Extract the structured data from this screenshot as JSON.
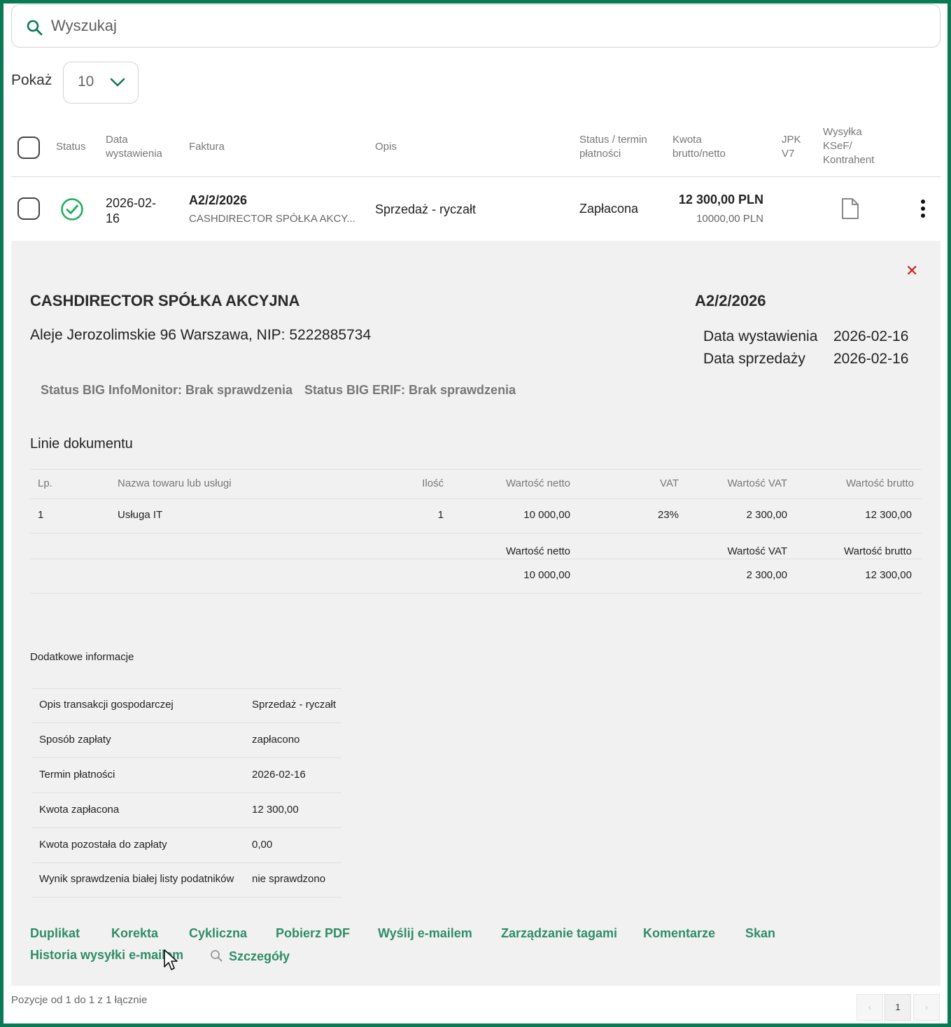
{
  "search": {
    "placeholder": "Wyszukaj"
  },
  "show": {
    "label": "Pokaż",
    "value": "10"
  },
  "table": {
    "headers": {
      "status": "Status",
      "date_line1": "Data",
      "date_line2": "wystawienia",
      "invoice": "Faktura",
      "description": "Opis",
      "payment_line1": "Status / termin",
      "payment_line2": "płatności",
      "amount_line1": "Kwota",
      "amount_line2": "brutto/netto",
      "jpk_line1": "JPK",
      "jpk_line2": "V7",
      "ksef_line1": "Wysyłka",
      "ksef_line2": "KSeF/",
      "ksef_line3": "Kontrahent"
    },
    "row": {
      "date_line1": "2026-02-",
      "date_line2": "16",
      "invoice_number": "A2/2/2026",
      "contractor": "CASHDIRECTOR SPÓŁKA AKCY...",
      "description": "Sprzedaż - ryczałt",
      "payment_status": "Zapłacona",
      "amount_gross": "12 300,00 PLN",
      "amount_net": "10000,00 PLN"
    }
  },
  "detail": {
    "close_symbol": "✕",
    "company": "CASHDIRECTOR SPÓŁKA AKCYJNA",
    "address": "Aleje Jerozolimskie 96 Warszawa, NIP: 5222885734",
    "invoice_number": "A2/2/2026",
    "issue_date_label": "Data wystawienia",
    "issue_date": "2026-02-16",
    "sale_date_label": "Data sprzedaży",
    "sale_date": "2026-02-16",
    "big_infomonitor": "Status BIG InfoMonitor: Brak sprawdzenia",
    "big_erif": "Status BIG ERIF: Brak sprawdzenia",
    "lines_title": "Linie dokumentu",
    "lines_headers": {
      "lp": "Lp.",
      "name": "Nazwa towaru lub usługi",
      "qty": "Ilość",
      "net": "Wartość netto",
      "vat": "VAT",
      "vat_value": "Wartość VAT",
      "gross": "Wartość brutto"
    },
    "lines": [
      {
        "lp": "1",
        "name": "Usługa IT",
        "qty": "1",
        "net": "10 000,00",
        "vat": "23%",
        "vat_value": "2 300,00",
        "gross": "12 300,00"
      }
    ],
    "totals": {
      "net_label": "Wartość netto",
      "vat_label": "Wartość VAT",
      "gross_label": "Wartość brutto",
      "net": "10 000,00",
      "vat": "2 300,00",
      "gross": "12 300,00"
    },
    "info_title": "Dodatkowe informacje",
    "info": [
      {
        "label": "Opis transakcji gospodarczej",
        "value": "Sprzedaż - ryczałt"
      },
      {
        "label": "Sposób zapłaty",
        "value": "zapłacono"
      },
      {
        "label": "Termin płatności",
        "value": "2026-02-16"
      },
      {
        "label": "Kwota zapłacona",
        "value": "12 300,00"
      },
      {
        "label": "Kwota pozostała do zapłaty",
        "value": "0,00"
      },
      {
        "label": "Wynik sprawdzenia białej listy podatników",
        "value": "nie sprawdzono"
      }
    ],
    "actions": {
      "duplicate": "Duplikat",
      "correction": "Korekta",
      "cyclic": "Cykliczna",
      "download_pdf": "Pobierz PDF",
      "send_email": "Wyślij e-mailem",
      "tags": "Zarządzanie tagami",
      "comments": "Komentarze",
      "scan": "Skan",
      "email_history": "Historia wysyłki e-mailem",
      "details": "Szczegóły"
    }
  },
  "footer": {
    "summary": "Pozycje od 1 do 1 z 1 łącznie",
    "prev": "‹",
    "page": "1",
    "next": "›"
  },
  "colors": {
    "brand_green": "#0a7a55",
    "link_green": "#2e8d69",
    "close_red": "#d01d1d",
    "panel_bg": "#f1f1f1"
  }
}
